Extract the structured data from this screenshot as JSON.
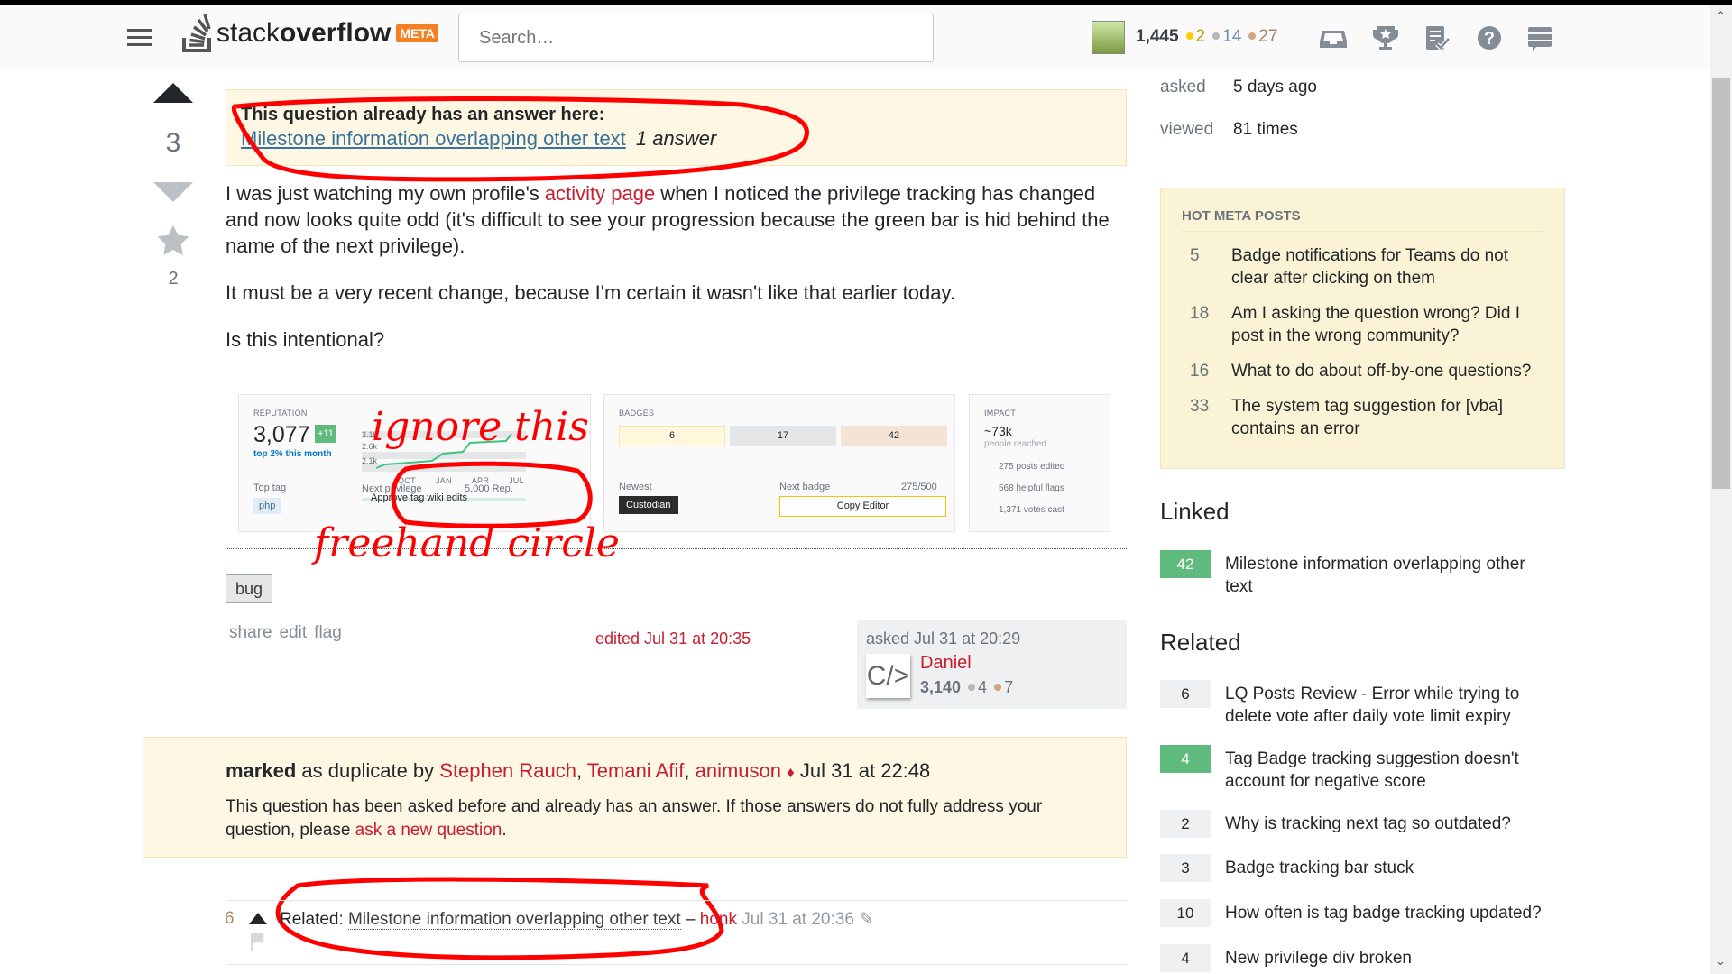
{
  "header": {
    "logo_text_light": "stack",
    "logo_text_bold": "overflow",
    "logo_badge": "META",
    "search_placeholder": "Search…",
    "reputation": "1,445",
    "gold": "2",
    "silver": "14",
    "bronze": "27",
    "icons": [
      "inbox-icon",
      "achievements-icon",
      "review-icon",
      "help-icon",
      "site-switcher-icon"
    ]
  },
  "question": {
    "votes": "3",
    "favorites": "2",
    "duplicate_notice": {
      "heading": "This question already has an answer here:",
      "link": "Milestone information overlapping other text",
      "answers": "1 answer"
    },
    "body": {
      "p1_before": "I was just watching my own profile's ",
      "p1_link": "activity page",
      "p1_after": " when I noticed the privilege tracking has changed and now looks quite odd (it's difficult to see your progression because the green bar is hid behind the name of the next privilege).",
      "p2": "It must be a very recent change, because I'm certain it wasn't like that earlier today.",
      "p3": "Is this intentional?"
    },
    "embedded": {
      "rep_label": "REPUTATION",
      "rep": "3,077",
      "rep_change": "+11",
      "rep_rank": "top 2% this month",
      "graph_ticks": [
        "3.1k",
        "2.6k",
        "2.1k"
      ],
      "months": [
        "OCT",
        "JAN",
        "APR",
        "JUL"
      ],
      "top_tag_label": "Top tag",
      "top_tag": "php",
      "next_priv_label": "Next privilege",
      "next_priv_rep": "5,000 Rep.",
      "next_priv_name": "Approve tag wiki edits",
      "badges_label": "BADGES",
      "gold": "6",
      "silver": "17",
      "bronze": "42",
      "newest_label": "Newest",
      "newest_badge": "Custodian",
      "next_badge_label": "Next badge",
      "next_badge_progress": "275/500",
      "next_badge": "Copy Editor",
      "impact_label": "IMPACT",
      "impact": "~73k",
      "impact_sub": "people reached",
      "posts_edited": "275 posts edited",
      "helpful_flags": "568 helpful flags",
      "votes_cast": "1,371 votes cast"
    },
    "annotations": {
      "ignore": "ignore this",
      "freehand": "freehand circle"
    },
    "tag": "bug",
    "menu": [
      "share",
      "edit",
      "flag"
    ],
    "edited": "edited Jul 31 at 20:35",
    "asked": "asked Jul 31 at 20:29",
    "user": "Daniel",
    "user_rep": "3,140",
    "user_silver": "4",
    "user_bronze": "7"
  },
  "duplicate": {
    "marked": "marked",
    "as_dup_by": " as duplicate by ",
    "users": [
      "Stephen Rauch",
      "Temani Afif",
      "animuson"
    ],
    "mod": "♦",
    "time": " Jul 31 at 22:48",
    "text": "This question has been asked before and already has an answer. If those answers do not fully address your question, please ",
    "link": "ask a new question",
    "end": "."
  },
  "comment": {
    "score": "6",
    "prefix": "Related: ",
    "link": "Milestone information overlapping other text",
    "dash": " – ",
    "user": "honk",
    "time": "Jul 31 at 20:36"
  },
  "sidebar": {
    "asked_label": "asked",
    "asked": "5 days ago",
    "viewed_label": "viewed",
    "viewed": "81 times",
    "hot_title": "HOT META POSTS",
    "hot": [
      {
        "n": "5",
        "t": "Badge notifications for Teams do not clear after clicking on them"
      },
      {
        "n": "18",
        "t": "Am I asking the question wrong? Did I post in the wrong community?"
      },
      {
        "n": "16",
        "t": "What to do about off-by-one questions?"
      },
      {
        "n": "33",
        "t": "The system tag suggestion for [vba] contains an error"
      }
    ],
    "linked_title": "Linked",
    "linked": [
      {
        "s": "42",
        "t": "Milestone information overlapping other text",
        "answered": true
      }
    ],
    "related_title": "Related",
    "related": [
      {
        "s": "6",
        "t": "LQ Posts Review - Error while trying to delete vote after daily vote limit expiry",
        "answered": false
      },
      {
        "s": "4",
        "t": "Tag Badge tracking suggestion doesn't account for negative score",
        "answered": true
      },
      {
        "s": "2",
        "t": "Why is tracking next tag so outdated?",
        "answered": false
      },
      {
        "s": "3",
        "t": "Badge tracking bar stuck",
        "answered": false
      },
      {
        "s": "10",
        "t": "How often is tag badge tracking updated?",
        "answered": false
      },
      {
        "s": "4",
        "t": "New privilege div broken",
        "answered": false
      }
    ]
  },
  "colors": {
    "link_red": "#c91d2e",
    "accent": "#f48024",
    "answered": "#5eba7d",
    "notice_bg": "#fdf7e3",
    "annotation": "#ff0000"
  }
}
